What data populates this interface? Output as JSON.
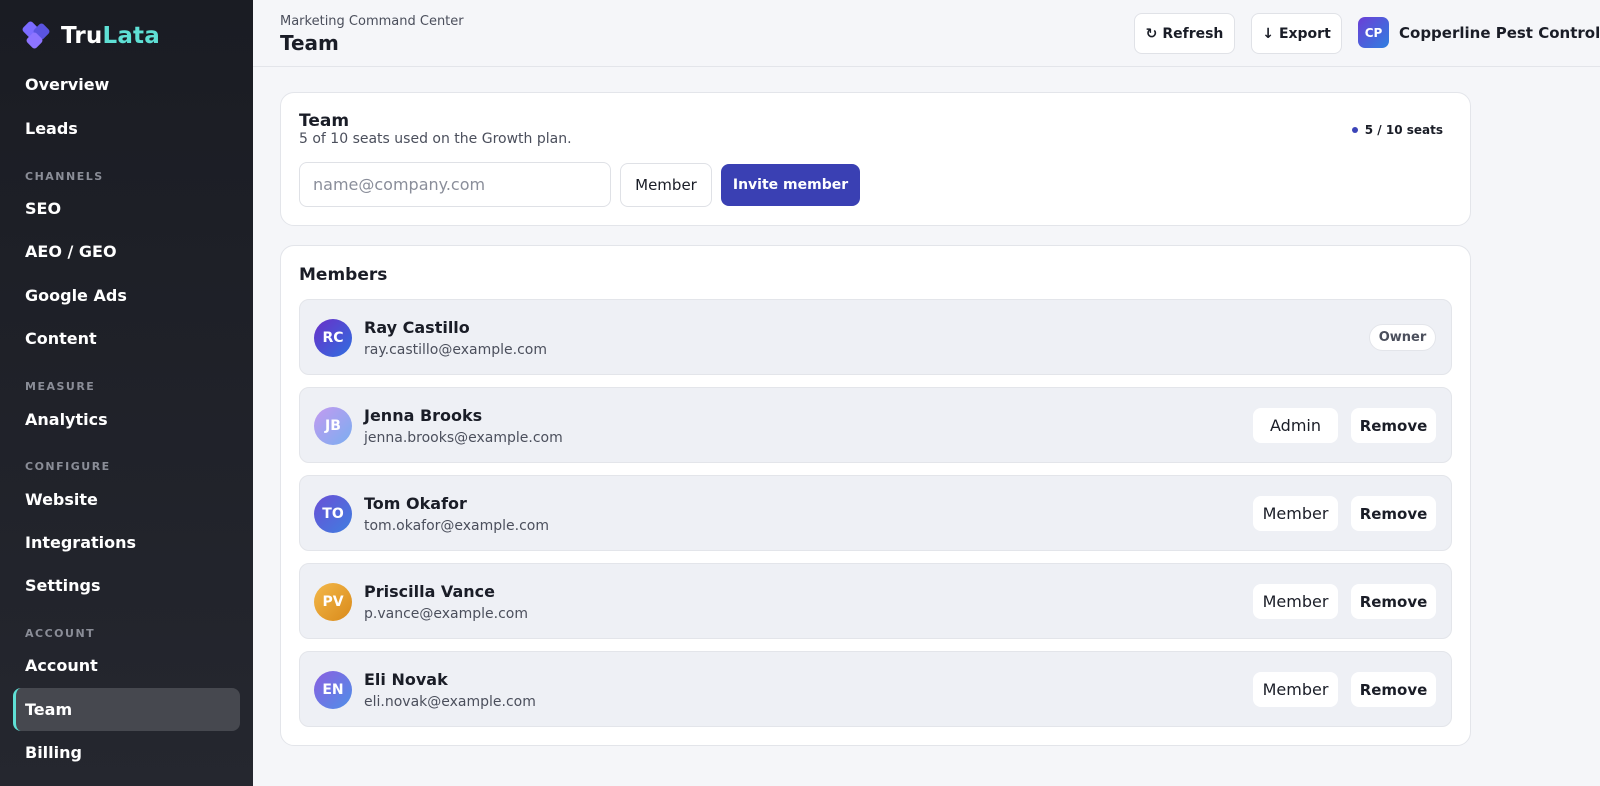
{
  "brand": {
    "prefix": "Tru",
    "accent": "Lata"
  },
  "sidebar": {
    "top_items": [
      {
        "label": "Overview"
      },
      {
        "label": "Leads"
      }
    ],
    "sections": [
      {
        "title": "CHANNELS",
        "items": [
          {
            "label": "SEO"
          },
          {
            "label": "AEO / GEO"
          },
          {
            "label": "Google Ads"
          },
          {
            "label": "Content"
          }
        ]
      },
      {
        "title": "MEASURE",
        "items": [
          {
            "label": "Analytics"
          }
        ]
      },
      {
        "title": "CONFIGURE",
        "items": [
          {
            "label": "Website"
          },
          {
            "label": "Integrations"
          },
          {
            "label": "Settings"
          }
        ]
      },
      {
        "title": "ACCOUNT",
        "items": [
          {
            "label": "Account"
          },
          {
            "label": "Team",
            "active": true
          },
          {
            "label": "Billing"
          }
        ]
      }
    ]
  },
  "header": {
    "subtitle": "Marketing Command Center",
    "title": "Team",
    "refresh_label": "Refresh",
    "export_label": "Export",
    "org_initials": "CP",
    "org_name": "Copperline Pest Control"
  },
  "team_card": {
    "title": "Team",
    "subtitle": "5 of 10 seats used on the Growth plan.",
    "seats_label": "5 / 10 seats",
    "seats_used": 5,
    "seats_total": 10,
    "email_placeholder": "name@company.com",
    "email_value": "",
    "role_value": "Member",
    "invite_label": "Invite member"
  },
  "members_card": {
    "title": "Members",
    "remove_label": "Remove",
    "owner_label": "Owner",
    "members": [
      {
        "initials": "RC",
        "name": "Ray Castillo",
        "email": "ray.castillo@example.com",
        "role": "Owner",
        "avatar_from": "#6a2fc8",
        "avatar_to": "#2f6fe0"
      },
      {
        "initials": "JB",
        "name": "Jenna Brooks",
        "email": "jenna.brooks@example.com",
        "role": "Admin",
        "avatar_from": "#c39af0",
        "avatar_to": "#7aaef0"
      },
      {
        "initials": "TO",
        "name": "Tom Okafor",
        "email": "tom.okafor@example.com",
        "role": "Member",
        "avatar_from": "#6a4fd6",
        "avatar_to": "#3f7fe0"
      },
      {
        "initials": "PV",
        "name": "Priscilla Vance",
        "email": "p.vance@example.com",
        "role": "Member",
        "avatar_from": "#f3b84a",
        "avatar_to": "#d98a1a"
      },
      {
        "initials": "EN",
        "name": "Eli Novak",
        "email": "eli.novak@example.com",
        "role": "Member",
        "avatar_from": "#8a5fe0",
        "avatar_to": "#4f8fe8"
      }
    ]
  },
  "colors": {
    "primary": "#3a40b3",
    "accent": "#5fe0d5",
    "sidebar_bg": "#1e2028"
  }
}
